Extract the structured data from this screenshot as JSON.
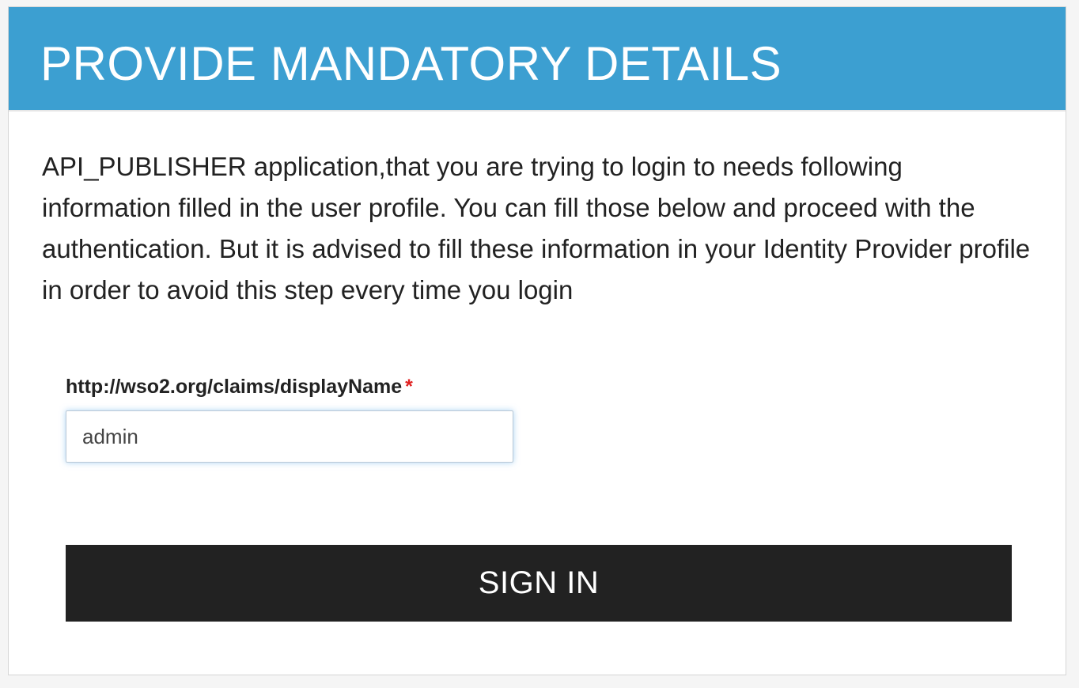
{
  "header": {
    "title": "PROVIDE MANDATORY DETAILS",
    "background_color": "#3c9fd1"
  },
  "description": "API_PUBLISHER application,that you are trying to login to needs following information filled in the user profile. You can fill those below and proceed with the authentication. But it is advised to fill these information in your Identity Provider profile in order to avoid this step every time you login",
  "form": {
    "field": {
      "label": "http://wso2.org/claims/displayName",
      "required_mark": "*",
      "value": "admin"
    },
    "submit_label": "SIGN IN",
    "submit_color": "#222222"
  }
}
